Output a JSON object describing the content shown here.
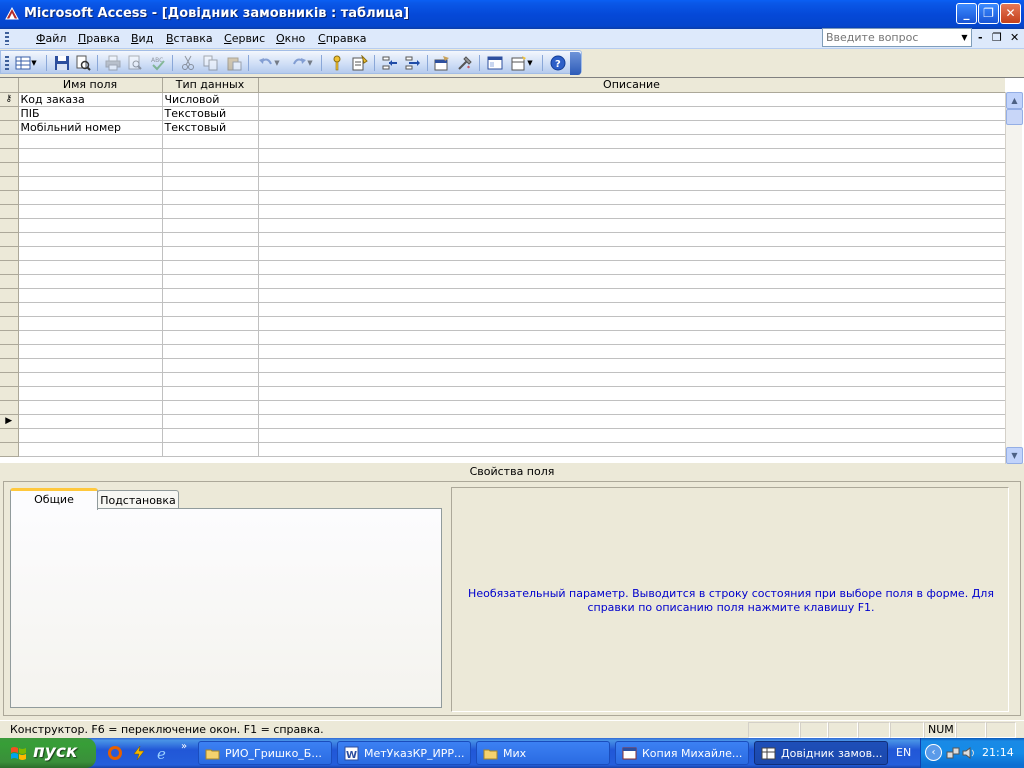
{
  "window": {
    "title": "Microsoft Access - [Довідник замовників : таблица]",
    "min_glyph": "_",
    "max_glyph": "❐",
    "close_glyph": "✕"
  },
  "menubar": {
    "items": [
      {
        "label": "Файл",
        "hot": "Ф",
        "rest": "айл"
      },
      {
        "label": "Правка",
        "hot": "П",
        "rest": "равка"
      },
      {
        "label": "Вид",
        "hot": "В",
        "rest": "ид"
      },
      {
        "label": "Вставка",
        "hot": "В",
        "rest": "ставка"
      },
      {
        "label": "Сервис",
        "hot": "С",
        "rest": "ервис"
      },
      {
        "label": "Окно",
        "hot": "О",
        "rest": "кно"
      },
      {
        "label": "Справка",
        "hot": "С",
        "rest": "правка"
      }
    ],
    "help_placeholder": "Введите вопрос",
    "mdi_min": "-",
    "mdi_restore": "❐",
    "mdi_close": "✕"
  },
  "toolbar": {
    "icons": [
      "view-icon",
      "save-icon",
      "search-icon",
      "print-icon",
      "print-preview-icon",
      "spelling-icon",
      "cut-icon",
      "copy-icon",
      "paste-icon",
      "undo-icon",
      "redo-icon",
      "primary-key-icon",
      "indexes-icon",
      "insert-rows-icon",
      "delete-rows-icon",
      "properties-icon",
      "build-icon",
      "database-window-icon",
      "new-object-icon",
      "help-icon"
    ]
  },
  "grid": {
    "headers": [
      "Имя поля",
      "Тип данных",
      "Описание"
    ],
    "rows": [
      {
        "name": "Код заказа",
        "type": "Числовой",
        "desc": "",
        "key": true
      },
      {
        "name": "ПІБ",
        "type": "Текстовый",
        "desc": "",
        "key": false
      },
      {
        "name": "Мобільний номер",
        "type": "Текстовый",
        "desc": "",
        "key": false
      }
    ],
    "key_glyph": "⚷",
    "current_glyph": "▶"
  },
  "properties": {
    "title": "Свойства поля",
    "tabs": [
      "Общие",
      "Подстановка"
    ],
    "help_text": "Необязательный параметр.  Выводится в строку состояния при выборе поля в форме.  Для справки по описанию поля нажмите клавишу F1."
  },
  "statusbar": {
    "text": "Конструктор.  F6 = переключение окон.  F1 = справка.",
    "num": "NUM"
  },
  "taskbar": {
    "start_label": "пуск",
    "quicklaunch": [
      "firefox-icon",
      "winamp-icon",
      "ie-icon"
    ],
    "more": "»",
    "tasks": [
      {
        "label": "РИО_Гришко_Б...",
        "icon": "folder-icon"
      },
      {
        "label": "МетУказКР_ИРР...",
        "icon": "word-icon"
      },
      {
        "label": "Мих",
        "icon": "folder-icon"
      },
      {
        "label": "Копия Михайле...",
        "icon": "access-icon"
      },
      {
        "label": "Довідник замов...",
        "icon": "table-icon"
      }
    ],
    "lang": "EN",
    "tray_chevron": "‹",
    "clock": "21:14"
  }
}
